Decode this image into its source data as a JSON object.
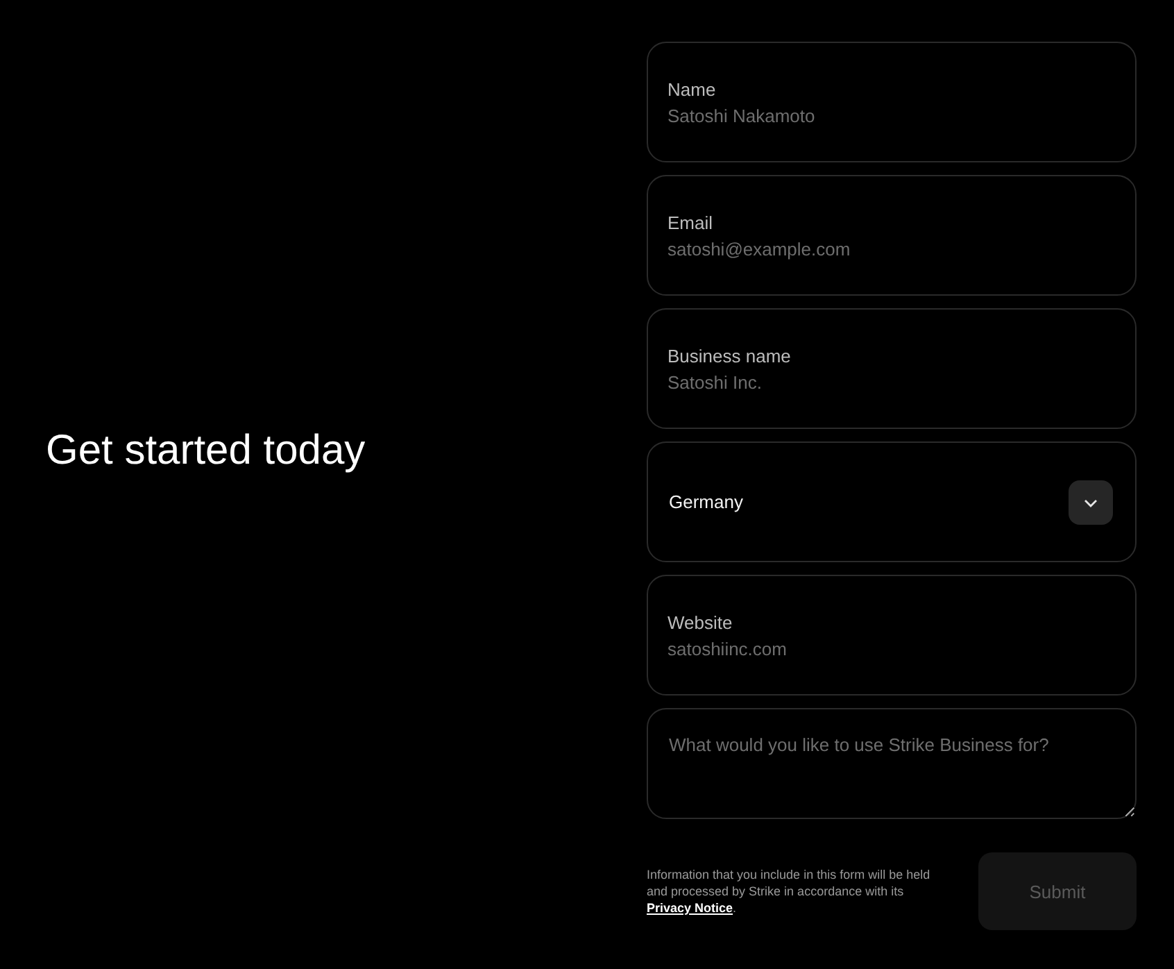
{
  "heading": "Get started today",
  "fields": [
    {
      "kind": "text",
      "label": "Name",
      "placeholder": "Satoshi Nakamoto"
    },
    {
      "kind": "text",
      "label": "Email",
      "placeholder": "satoshi@example.com"
    },
    {
      "kind": "text",
      "label": "Business name",
      "placeholder": "Satoshi Inc."
    },
    {
      "kind": "select",
      "value": "Germany"
    },
    {
      "kind": "text",
      "label": "Website",
      "placeholder": "satoshiinc.com"
    },
    {
      "kind": "textarea",
      "placeholder": "What would you like to use Strike Business for?"
    }
  ],
  "notice": {
    "text": "Information that you include in this form will be held and processed by Strike in accordance with its",
    "link": "Privacy Notice",
    "end": "."
  },
  "submit": {
    "label": "Submit",
    "disabled": true
  }
}
